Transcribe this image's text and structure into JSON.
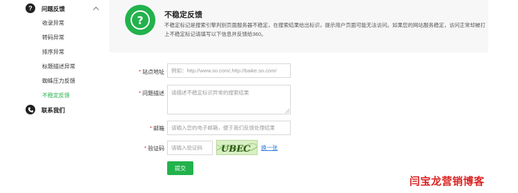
{
  "sidebar": {
    "feedback_section": {
      "title": "问题反馈",
      "icon": "question-circle-icon"
    },
    "items": [
      {
        "label": "收录异常"
      },
      {
        "label": "转码异常"
      },
      {
        "label": "排序异常"
      },
      {
        "label": "标题描述异常"
      },
      {
        "label": "蜘蛛压力反馈"
      },
      {
        "label": "不稳定反馈",
        "active": true
      }
    ],
    "contact_section": {
      "title": "联系我们",
      "icon": "phone-icon"
    }
  },
  "header": {
    "icon": "question-circle-icon",
    "title": "不稳定反馈",
    "description": "不稳定标记是搜索引擎判别页面服务器不稳定，在搜索结果给出标识，提示用户页面可能无法访问。如果您的网站服务稳定，访问正常却被打上不稳定标记请填写以下信息并反馈给360。"
  },
  "form": {
    "site_url": {
      "label": "站点地址",
      "required": true,
      "placeholder": "例如：http://www.so.com/,http://baike.so.com/"
    },
    "description": {
      "label": "问题描述",
      "required": true,
      "placeholder": "请描述不稳定标识异常的搜索结果"
    },
    "email": {
      "label": "邮箱",
      "required": true,
      "placeholder": "请输入您的电子邮箱，便于我们反馈处理结果"
    },
    "captcha": {
      "label": "验证码",
      "required": true,
      "placeholder": "请输入验证码",
      "image_text": "UBEC",
      "refresh_label": "换一张"
    },
    "submit_label": "提交"
  },
  "watermark": "闫宝龙营销博客",
  "colors": {
    "accent": "#22b24c",
    "required": "#e33333",
    "link": "#2a7ad8",
    "watermark": "#d92323"
  }
}
